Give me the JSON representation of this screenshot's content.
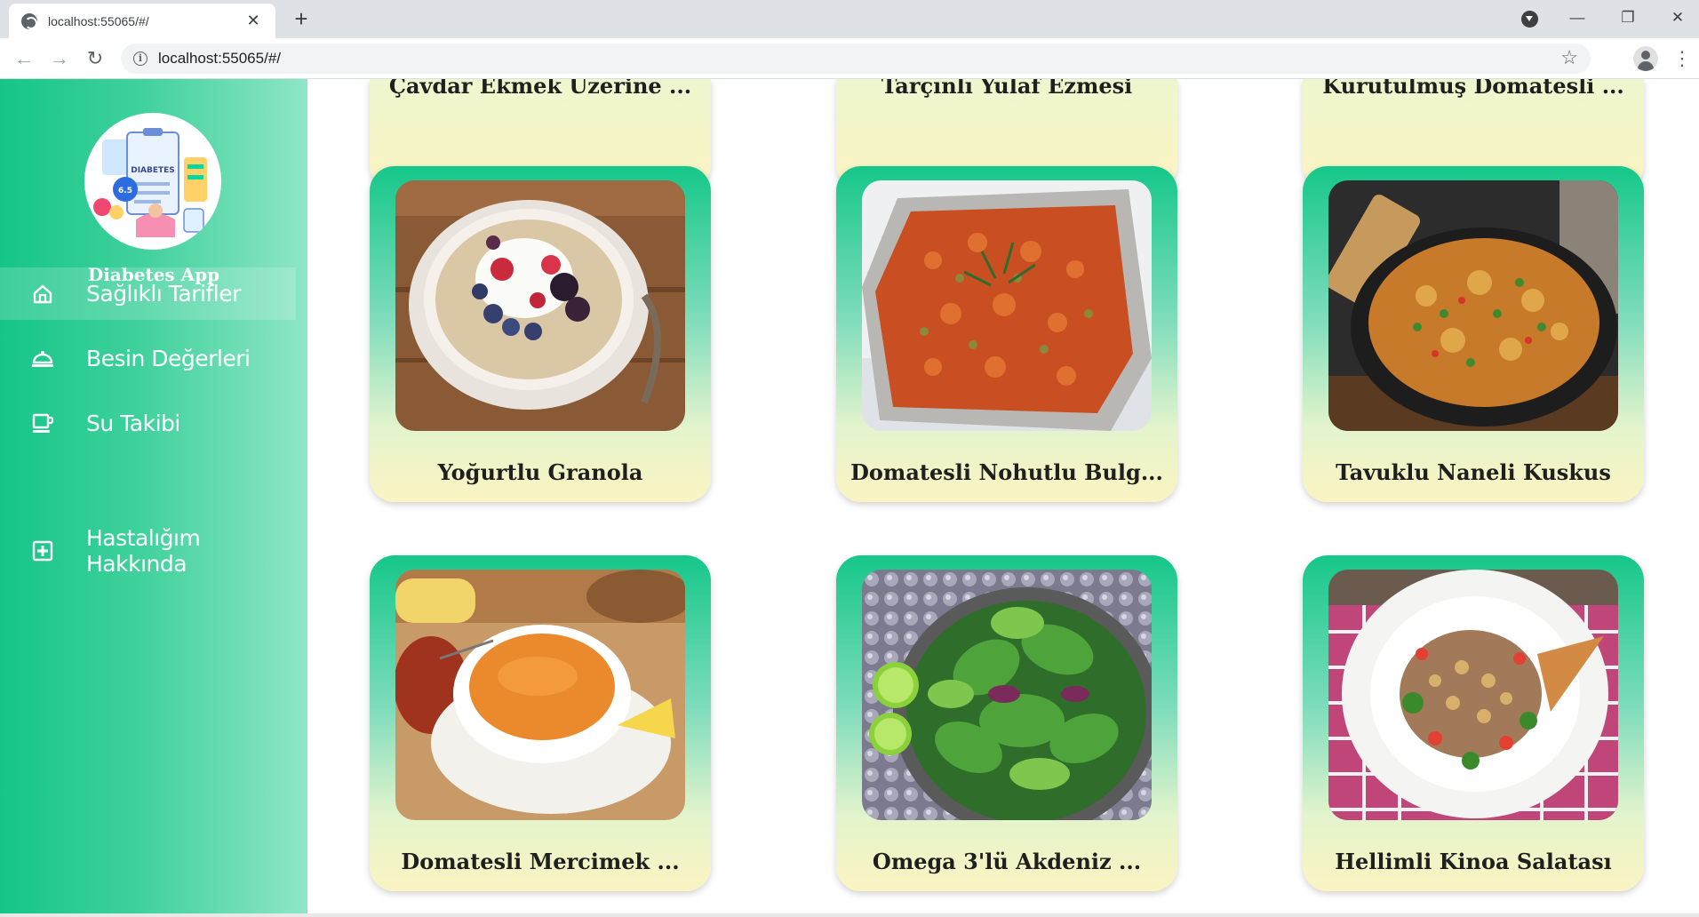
{
  "browser": {
    "tab_title": "localhost:55065/#/",
    "tab_close": "✕",
    "new_tab": "+",
    "url": "localhost:55065/#/",
    "win_minimize": "—",
    "win_restore": "❐",
    "win_close": "✕"
  },
  "sidebar": {
    "app_name": "Diabetes App",
    "logo_text": "DIABETES",
    "logo_badge": "6.5",
    "items": [
      {
        "label": "Sağlıklı Tarifler",
        "icon": "home-icon",
        "active": true
      },
      {
        "label": "Besin Değerleri",
        "icon": "food-dome-icon",
        "active": false
      },
      {
        "label": "Su Takibi",
        "icon": "cup-icon",
        "active": false
      },
      {
        "label": "Hastalığım Hakkında",
        "icon": "medical-plus-icon",
        "active": false
      }
    ]
  },
  "recipes": {
    "top_row": [
      {
        "title": "Çavdar Ekmek Üzerine ..."
      },
      {
        "title": "Tarçınlı Yulaf Ezmesi"
      },
      {
        "title": "Kurutulmuş Domatesli ..."
      }
    ],
    "grid": [
      {
        "title": "Yoğurtlu Granola",
        "image": "granola-bowl"
      },
      {
        "title": "Domatesli Nohutlu Bulg...",
        "image": "bulgur-dish"
      },
      {
        "title": "Tavuklu Naneli Kuskus",
        "image": "couscous-pan"
      },
      {
        "title": "Domatesli Mercimek ...",
        "image": "lentil-soup"
      },
      {
        "title": "Omega 3'lü Akdeniz ...",
        "image": "green-salad"
      },
      {
        "title": "Hellimli Kinoa Salatası",
        "image": "quinoa-salad"
      }
    ]
  },
  "colors": {
    "sidebar_green": "#15c587",
    "card_top": "#16c78a",
    "card_bottom": "#fbf4c2"
  }
}
